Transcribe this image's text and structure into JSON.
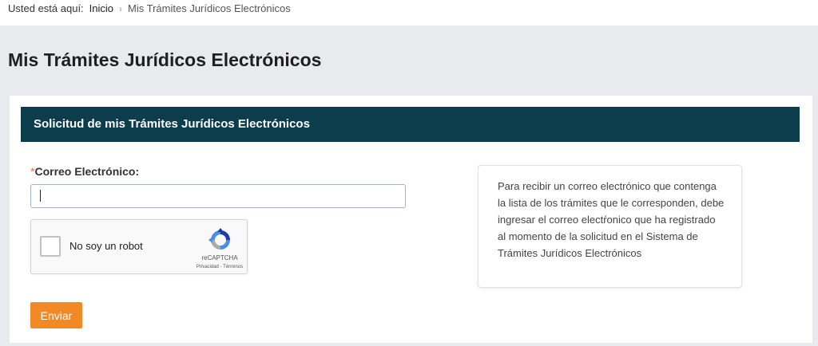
{
  "breadcrumb": {
    "prefix": "Usted está aquí:",
    "home": "Inicio",
    "separator": "›",
    "current": "Mis Trámites Jurídicos Electrónicos"
  },
  "page": {
    "title": "Mis Trámites Jurídicos Electrónicos"
  },
  "form": {
    "header": "Solicitud de mis Trámites Jurídicos Electrónicos",
    "email": {
      "required_mark": "*",
      "label": "Correo Electrónico:",
      "value": ""
    },
    "recaptcha": {
      "label": "No soy un robot",
      "brand": "reCAPTCHA",
      "terms": "Privacidad - Términos"
    },
    "submit_label": "Enviar"
  },
  "info": {
    "text": "Para recibir un correo electrónico que contenga la lista de los trámites que le corresponden, debe ingresar el correo electŕonico que ha registrado al momento de la solicitud en el Sistema de Trámites Jurídicos Electrónicos"
  },
  "colors": {
    "header_bg": "#0c3d4c",
    "accent": "#f18a24",
    "page_bg": "#e8eaed"
  }
}
